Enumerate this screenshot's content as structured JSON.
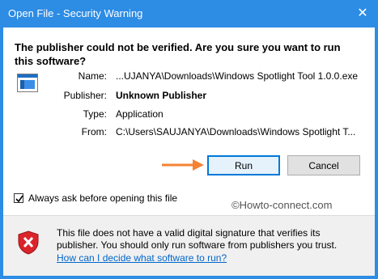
{
  "window": {
    "title": "Open File - Security Warning",
    "close_glyph": "✕"
  },
  "dialog": {
    "headline": "The publisher could not be verified.  Are you sure you want to run this software?",
    "file_icon": "application-window-icon",
    "fields": {
      "name_label": "Name:",
      "name_value": "...UJANYA\\Downloads\\Windows Spotlight Tool 1.0.0.exe",
      "publisher_label": "Publisher:",
      "publisher_value": "Unknown Publisher",
      "type_label": "Type:",
      "type_value": "Application",
      "from_label": "From:",
      "from_value": "C:\\Users\\SAUJANYA\\Downloads\\Windows Spotlight T..."
    },
    "buttons": {
      "run": "Run",
      "cancel": "Cancel"
    },
    "checkbox": {
      "label": "Always ask before opening this file",
      "checked": true
    },
    "watermark": "©Howto-connect.com"
  },
  "footer": {
    "icon": "red-shield-x-icon",
    "message": "This file does not have a valid digital signature that verifies its publisher.  You should only run software from publishers you trust.",
    "link": "How can I decide what software to run?"
  },
  "colors": {
    "titlebar": "#2d8ce4",
    "accent": "#0078d7",
    "arrow": "#f58232",
    "link": "#0066cc",
    "shield": "#d9252a"
  }
}
